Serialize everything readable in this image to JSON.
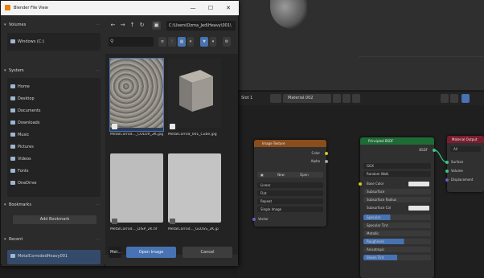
{
  "dialog": {
    "title": "Blender File View",
    "win_minimize": "—",
    "win_maximize": "☐",
    "win_close": "✕",
    "path": "C:\\Users\\Ozma_Jed\\Heavy\\001\\",
    "filename_value": "Met...",
    "open_label": "Open Image",
    "cancel_label": "Cancel",
    "volumes": {
      "header": "Volumes",
      "items": [
        "Windows (C:)"
      ]
    },
    "system": {
      "header": "System",
      "items": [
        "Home",
        "Desktop",
        "Documents",
        "Downloads",
        "Music",
        "Pictures",
        "Videos",
        "Fonts",
        "OneDrive"
      ]
    },
    "bookmarks": {
      "header": "Bookmarks",
      "add_label": "Add Bookmark"
    },
    "recent": {
      "header": "Recent",
      "items": [
        "MetalCorrodedHeavy001"
      ]
    },
    "files": [
      {
        "label": "MetalCorrod..._COLOR_2K.jpg",
        "kind": "image"
      },
      {
        "label": "MetalCorrod_001_Cube.jpg",
        "kind": "cube"
      },
      {
        "label": "MetalCorrod..._DISP_2K.tif",
        "kind": "plain"
      },
      {
        "label": "MetalCorrod..._GLOSS_2K.jp",
        "kind": "plain"
      }
    ]
  },
  "nodebar": {
    "slot": "Slot 1",
    "material": "Material.002"
  },
  "image_node": {
    "title": "Image Texture",
    "out_color": "Color",
    "out_alpha": "Alpha",
    "new_label": "New",
    "open_label": "Open",
    "row1": "Linear",
    "row2": "Flat",
    "row3": "Repeat",
    "row4": "Single Image",
    "vector": "Vector"
  },
  "bsdf_node": {
    "title": "Principled BSDF",
    "out": "BSDF",
    "rows": [
      "GGX",
      "Random Walk",
      "Base Color",
      "Subsurface",
      "Subsurface Radius",
      "Subsurface Col",
      "Specular",
      "Specular Tint",
      "Metallic",
      "Roughness",
      "Anisotropic",
      "Sheen Tint"
    ]
  },
  "output_node": {
    "title": "Material Output",
    "target": "All",
    "inputs": [
      "Surface",
      "Volume",
      "Displacement"
    ]
  }
}
